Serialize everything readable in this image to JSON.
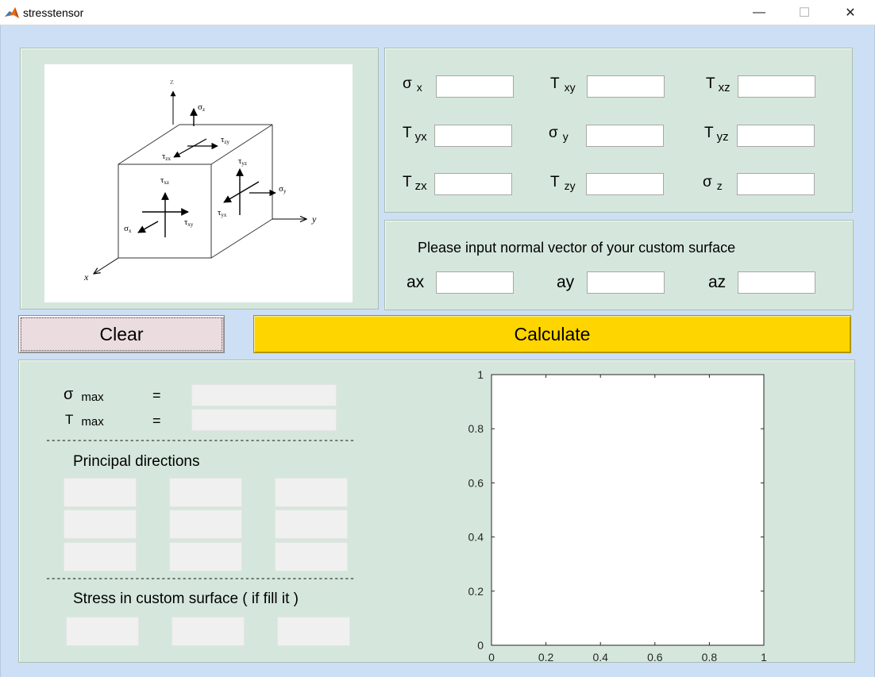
{
  "window": {
    "title": "stresstensor",
    "minimize_glyph": "—",
    "maximize_glyph": "☐",
    "close_glyph": "✕",
    "icon": "matlab-icon"
  },
  "diagram": {
    "labels": {
      "z": "z",
      "y": "y",
      "x": "x",
      "sigma_z": "σ",
      "sigma_z_sub": "z",
      "sigma_y": "σ",
      "sigma_y_sub": "y",
      "sigma_x": "σ",
      "sigma_x_sub": "x",
      "tau_zy": "τ",
      "tau_zy_sub": "zy",
      "tau_zx": "τ",
      "tau_zx_sub": "zx",
      "tau_yz": "τ",
      "tau_yz_sub": "yz",
      "tau_xz": "τ",
      "tau_xz_sub": "xz",
      "tau_yx": "τ",
      "tau_yx_sub": "yx",
      "tau_xy": "τ",
      "tau_xy_sub": "xy"
    }
  },
  "tensor": {
    "sigma_x": {
      "sym": "σ",
      "sub": "x",
      "value": ""
    },
    "tau_xy": {
      "sym": "T",
      "sub": "xy",
      "value": ""
    },
    "tau_xz": {
      "sym": "T",
      "sub": "xz",
      "value": ""
    },
    "tau_yx": {
      "sym": "T",
      "sub": "yx",
      "value": ""
    },
    "sigma_y": {
      "sym": "σ",
      "sub": "y",
      "value": ""
    },
    "tau_yz": {
      "sym": "T",
      "sub": "yz",
      "value": ""
    },
    "tau_zx": {
      "sym": "T",
      "sub": "zx",
      "value": ""
    },
    "tau_zy": {
      "sym": "T",
      "sub": "zy",
      "value": ""
    },
    "sigma_z": {
      "sym": "σ",
      "sub": "z",
      "value": ""
    }
  },
  "normal": {
    "title": "Please input normal vector of your custom surface",
    "ax": {
      "label": "ax",
      "value": ""
    },
    "ay": {
      "label": "ay",
      "value": ""
    },
    "az": {
      "label": "az",
      "value": ""
    }
  },
  "buttons": {
    "clear": "Clear",
    "calculate": "Calculate"
  },
  "results": {
    "sigma_max": {
      "sym": "σ",
      "sub": "max",
      "eq": "="
    },
    "tau_max": {
      "sym": "T",
      "sub": "max",
      "eq": "="
    },
    "dashes": "-----------------------------------------------------------",
    "principal_title": "Principal directions",
    "custom_title": "Stress in custom surface ( if fill it )"
  },
  "chart_data": {
    "type": "line",
    "series": [],
    "x_ticks": [
      "0",
      "0.2",
      "0.4",
      "0.6",
      "0.8",
      "1"
    ],
    "y_ticks": [
      "0",
      "0.2",
      "0.4",
      "0.6",
      "0.8",
      "1"
    ],
    "xlim": [
      0,
      1
    ],
    "ylim": [
      0,
      1
    ],
    "grid": false
  },
  "colors": {
    "panel_bg": "#d5e7dc",
    "window_bg": "#cddff4",
    "calculate_bg": "#ffd500",
    "clear_bg": "#eadcdf"
  }
}
